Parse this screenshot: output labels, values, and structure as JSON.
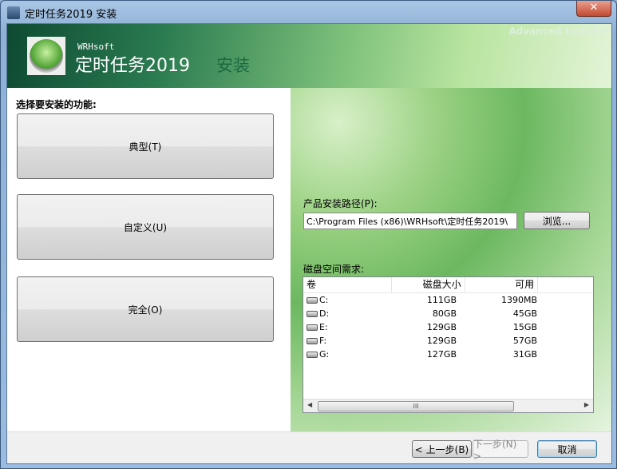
{
  "window": {
    "title": "定时任务2019 安装",
    "close": "✕"
  },
  "header": {
    "watermark": "Advanced Installer",
    "brand": "WRHsoft",
    "product": "定时任务2019",
    "action": "安装"
  },
  "features": {
    "heading": "选择要安装的功能:",
    "buttons": [
      "典型(T)",
      "自定义(U)",
      "完全(O)"
    ]
  },
  "install": {
    "path_label": "产品安装路径(P):",
    "path_value": "C:\\Program Files (x86)\\WRHsoft\\定时任务2019\\",
    "browse": "浏览..."
  },
  "disk": {
    "label": "磁盘空间需求:",
    "columns": [
      "卷",
      "磁盘大小",
      "可用"
    ],
    "rows": [
      [
        "C:",
        "111GB",
        "1390MB"
      ],
      [
        "D:",
        "80GB",
        "45GB"
      ],
      [
        "E:",
        "129GB",
        "15GB"
      ],
      [
        "F:",
        "129GB",
        "57GB"
      ],
      [
        "G:",
        "127GB",
        "31GB"
      ]
    ],
    "scroll_grip": "III"
  },
  "nav": {
    "back": "< 上一步(B)",
    "next": "下一步(N) >",
    "cancel": "取消"
  }
}
